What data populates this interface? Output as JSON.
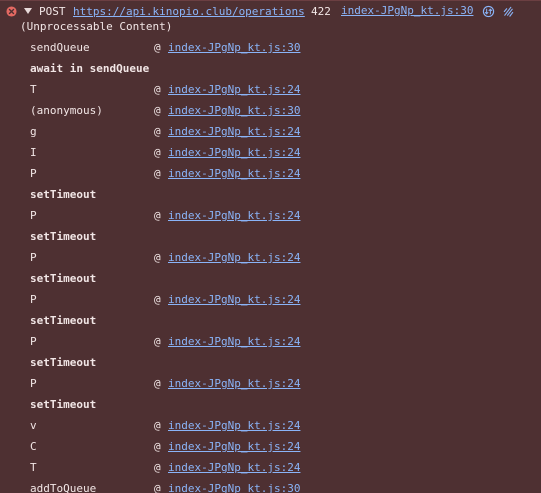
{
  "error": {
    "method": "POST",
    "url": "https://api.kinopio.club/operations",
    "status_code": "422",
    "status_text": "(Unprocessable Content)",
    "source": "index-JPgNp_kt.js:30"
  },
  "stack": [
    {
      "kind": "frame",
      "fn": "sendQueue",
      "at": "@",
      "loc": "index-JPgNp_kt.js:30"
    },
    {
      "kind": "async",
      "label": "await in sendQueue"
    },
    {
      "kind": "frame",
      "fn": "T",
      "at": "@",
      "loc": "index-JPgNp_kt.js:24"
    },
    {
      "kind": "frame",
      "fn": "(anonymous)",
      "at": "@",
      "loc": "index-JPgNp_kt.js:30"
    },
    {
      "kind": "frame",
      "fn": "g",
      "at": "@",
      "loc": "index-JPgNp_kt.js:24"
    },
    {
      "kind": "frame",
      "fn": "I",
      "at": "@",
      "loc": "index-JPgNp_kt.js:24"
    },
    {
      "kind": "frame",
      "fn": "P",
      "at": "@",
      "loc": "index-JPgNp_kt.js:24"
    },
    {
      "kind": "async",
      "label": "setTimeout"
    },
    {
      "kind": "frame",
      "fn": "P",
      "at": "@",
      "loc": "index-JPgNp_kt.js:24"
    },
    {
      "kind": "async",
      "label": "setTimeout"
    },
    {
      "kind": "frame",
      "fn": "P",
      "at": "@",
      "loc": "index-JPgNp_kt.js:24"
    },
    {
      "kind": "async",
      "label": "setTimeout"
    },
    {
      "kind": "frame",
      "fn": "P",
      "at": "@",
      "loc": "index-JPgNp_kt.js:24"
    },
    {
      "kind": "async",
      "label": "setTimeout"
    },
    {
      "kind": "frame",
      "fn": "P",
      "at": "@",
      "loc": "index-JPgNp_kt.js:24"
    },
    {
      "kind": "async",
      "label": "setTimeout"
    },
    {
      "kind": "frame",
      "fn": "P",
      "at": "@",
      "loc": "index-JPgNp_kt.js:24"
    },
    {
      "kind": "async",
      "label": "setTimeout"
    },
    {
      "kind": "frame",
      "fn": "v",
      "at": "@",
      "loc": "index-JPgNp_kt.js:24"
    },
    {
      "kind": "frame",
      "fn": "C",
      "at": "@",
      "loc": "index-JPgNp_kt.js:24"
    },
    {
      "kind": "frame",
      "fn": "T",
      "at": "@",
      "loc": "index-JPgNp_kt.js:24"
    },
    {
      "kind": "frame",
      "fn": "addToQueue",
      "at": "@",
      "loc": "index-JPgNp_kt.js:30"
    }
  ],
  "icons": {
    "error": "error-circle-icon",
    "toggle": "triangle-expanded-icon",
    "network": "network-request-icon",
    "ai": "ai-assist-icon"
  },
  "colors": {
    "background": "#4e3032",
    "error_icon": "#e46962",
    "link": "#8ab4f8",
    "text": "#f2e6e6"
  }
}
